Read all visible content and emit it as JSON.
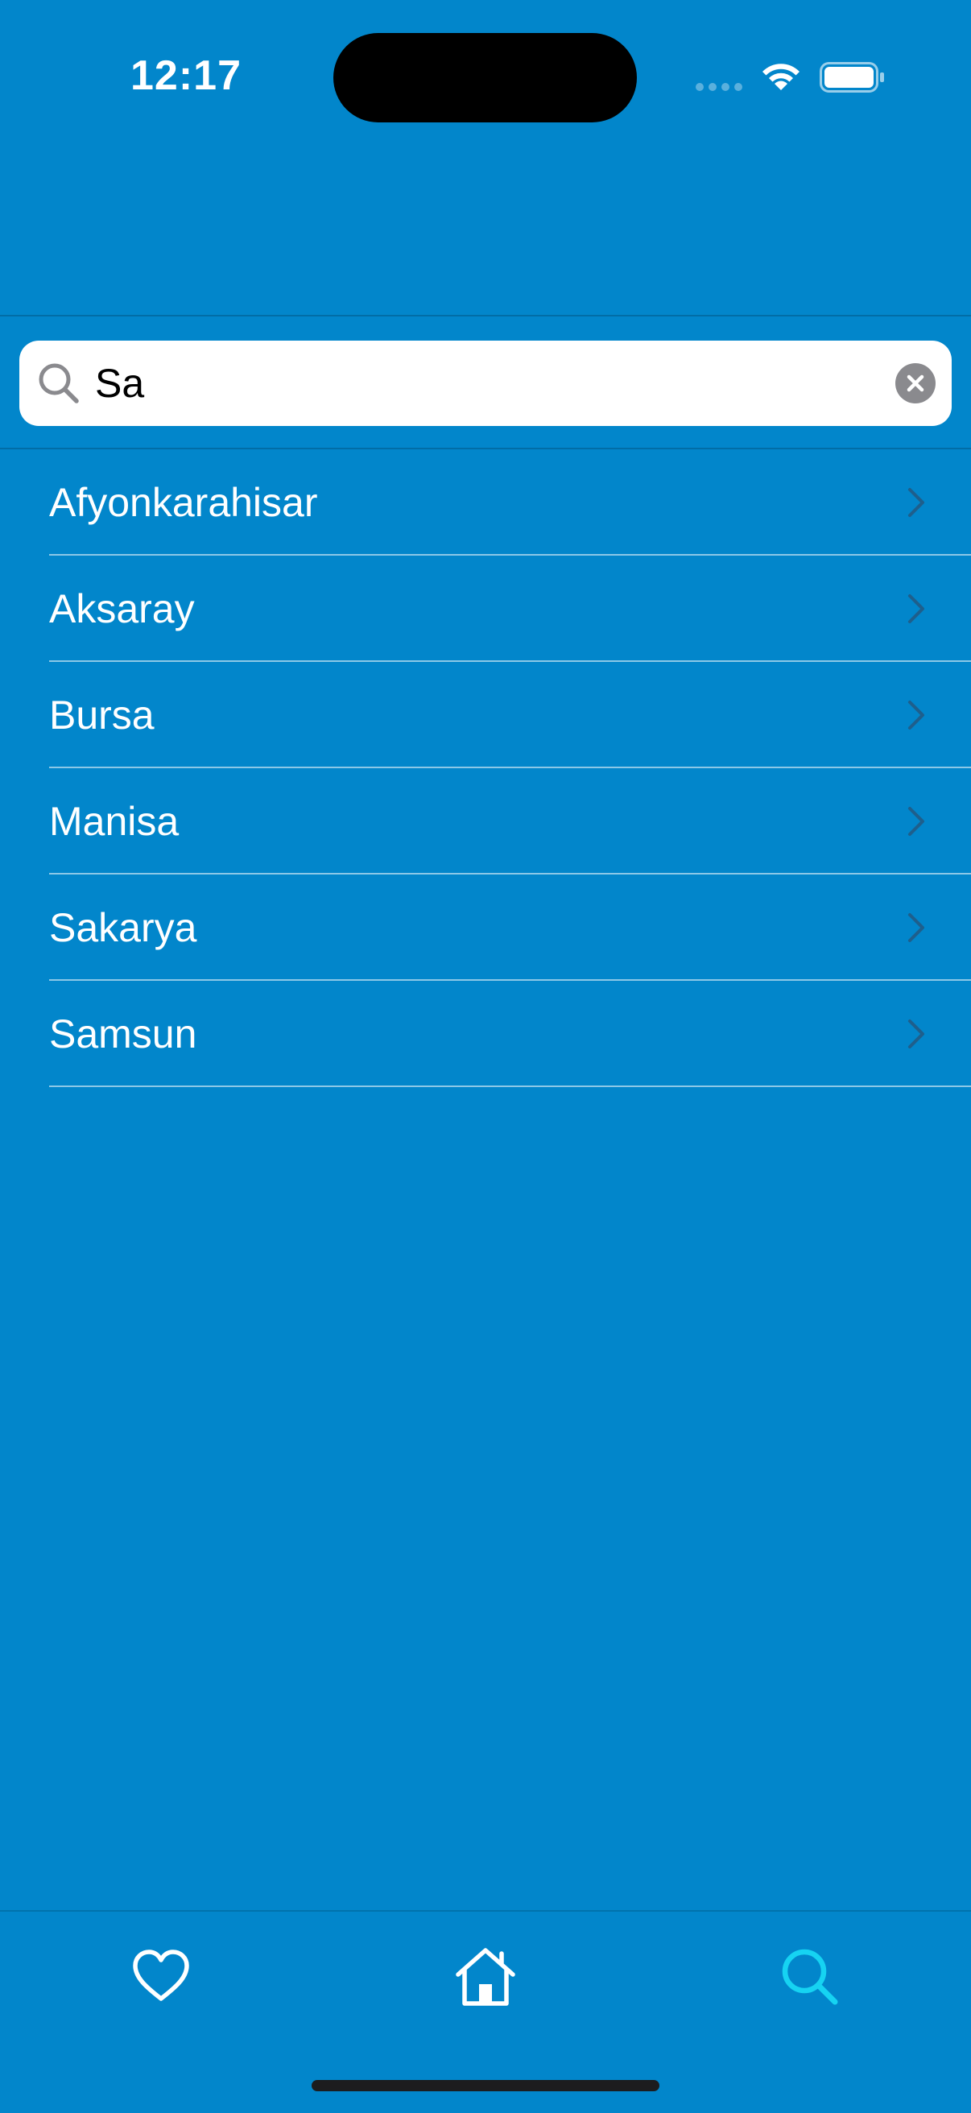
{
  "status_bar": {
    "time": "12:17"
  },
  "search": {
    "value": "Sa",
    "icon": "magnifying-glass",
    "clear_icon": "xmark-circle-fill"
  },
  "results": [
    {
      "label": "Afyonkarahisar"
    },
    {
      "label": "Aksaray"
    },
    {
      "label": "Bursa"
    },
    {
      "label": "Manisa"
    },
    {
      "label": "Sakarya"
    },
    {
      "label": "Samsun"
    }
  ],
  "tab_bar": {
    "tabs": [
      {
        "icon": "heart-icon",
        "selected": false
      },
      {
        "icon": "house-icon",
        "selected": false
      },
      {
        "icon": "search-icon",
        "selected": true
      }
    ]
  },
  "colors": {
    "background": "#0286CB",
    "accent_selected_tab": "#16D3F2",
    "text": "#FFFFFF",
    "chevron": "#1E5F8C"
  }
}
